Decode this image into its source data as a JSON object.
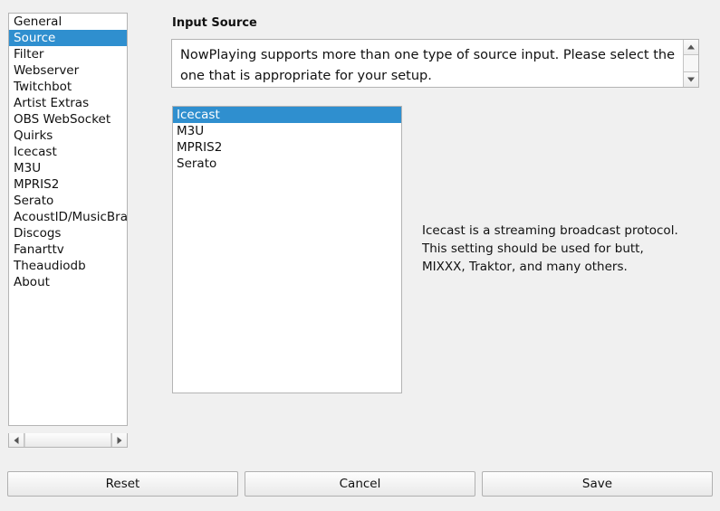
{
  "window": {
    "background_color": "#f0f0f0",
    "accent_color": "#2f8fcf"
  },
  "sidebar": {
    "items": [
      {
        "label": "General",
        "selected": false
      },
      {
        "label": "Source",
        "selected": true
      },
      {
        "label": "Filter",
        "selected": false
      },
      {
        "label": "Webserver",
        "selected": false
      },
      {
        "label": "Twitchbot",
        "selected": false
      },
      {
        "label": "Artist Extras",
        "selected": false
      },
      {
        "label": "OBS WebSocket",
        "selected": false
      },
      {
        "label": "Quirks",
        "selected": false
      },
      {
        "label": "Icecast",
        "selected": false
      },
      {
        "label": "M3U",
        "selected": false
      },
      {
        "label": "MPRIS2",
        "selected": false
      },
      {
        "label": "Serato",
        "selected": false
      },
      {
        "label": "AcoustID/MusicBrainz",
        "selected": false
      },
      {
        "label": "Discogs",
        "selected": false
      },
      {
        "label": "Fanarttv",
        "selected": false
      },
      {
        "label": "Theaudiodb",
        "selected": false
      },
      {
        "label": "About",
        "selected": false
      }
    ]
  },
  "main": {
    "group_label": "Input Source",
    "description": "NowPlaying supports more than one type of source input.  Please select the one that is appropriate for your setup.",
    "sources": [
      {
        "label": "Icecast",
        "selected": true
      },
      {
        "label": "M3U",
        "selected": false
      },
      {
        "label": "MPRIS2",
        "selected": false
      },
      {
        "label": "Serato",
        "selected": false
      }
    ],
    "source_help": "Icecast is a streaming broadcast protocol.  This setting should be used for butt, MIXXX, Traktor, and many others."
  },
  "buttons": {
    "reset": "Reset",
    "cancel": "Cancel",
    "save": "Save"
  }
}
